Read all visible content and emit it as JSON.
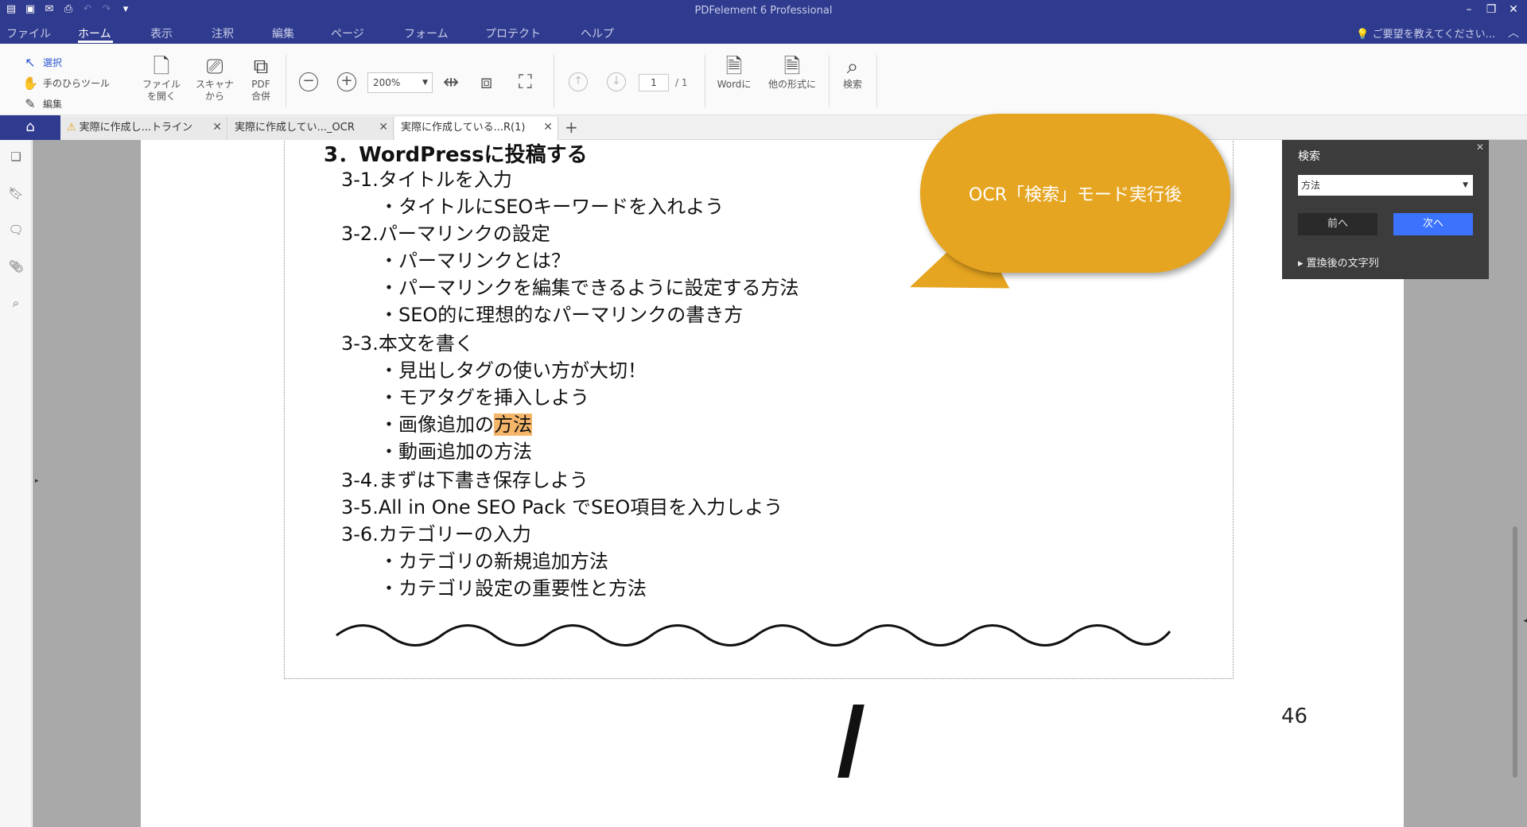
{
  "window": {
    "title": "PDFelement 6 Professional"
  },
  "menu": {
    "items": [
      "ファイル",
      "ホーム",
      "表示",
      "注釈",
      "編集",
      "ページ",
      "フォーム",
      "プロテクト",
      "ヘルプ"
    ],
    "active": "ホーム",
    "help_hint": "ご要望を教えてください..."
  },
  "ribbon": {
    "tools": [
      "選択",
      "手のひらツール",
      "編集"
    ],
    "open_file": [
      "ファイル",
      "を開く"
    ],
    "scanner": [
      "スキャナ",
      "から"
    ],
    "pdf_merge": [
      "PDF",
      "合併"
    ],
    "zoom": "200%",
    "page_current": "1",
    "page_total": "/ 1",
    "to_word": "Wordに",
    "to_other": "他の形式に",
    "search": "検索"
  },
  "tabs": [
    {
      "label": "実際に作成し...トライン",
      "warning": true
    },
    {
      "label": "実際に作成してい..._OCR",
      "warning": false
    },
    {
      "label": "実際に作成している...R(1)",
      "warning": false,
      "active": true
    }
  ],
  "document": {
    "lines": [
      "3．WordPressに投稿する",
      "3-1.タイトルを入力",
      "・タイトルにSEOキーワードを入れよう",
      "3-2.パーマリンクの設定",
      "・パーマリンクとは？",
      "・パーマリンクを編集できるように設定する方法",
      "・SEO的に理想的なパーマリンクの書き方",
      "3-3.本文を書く",
      "・見出しタグの使い方が大切！",
      "・モアタグを挿入しよう",
      "・画像追加の",
      "方法",
      "・動画追加の方法",
      "3-4.まずは下書き保存しよう",
      "3-5.All in One SEO Pack でSEO項目を入力しよう",
      "3-6.カテゴリーの入力",
      "・カテゴリの新規追加方法",
      "・カテゴリ設定の重要性と方法"
    ],
    "page_number": "46"
  },
  "callout": {
    "text": "OCR「検索」モード実行後"
  },
  "search_panel": {
    "title": "検索",
    "query": "方法",
    "prev": "前へ",
    "next": "次へ",
    "replace_toggle": "置換後の文字列"
  }
}
